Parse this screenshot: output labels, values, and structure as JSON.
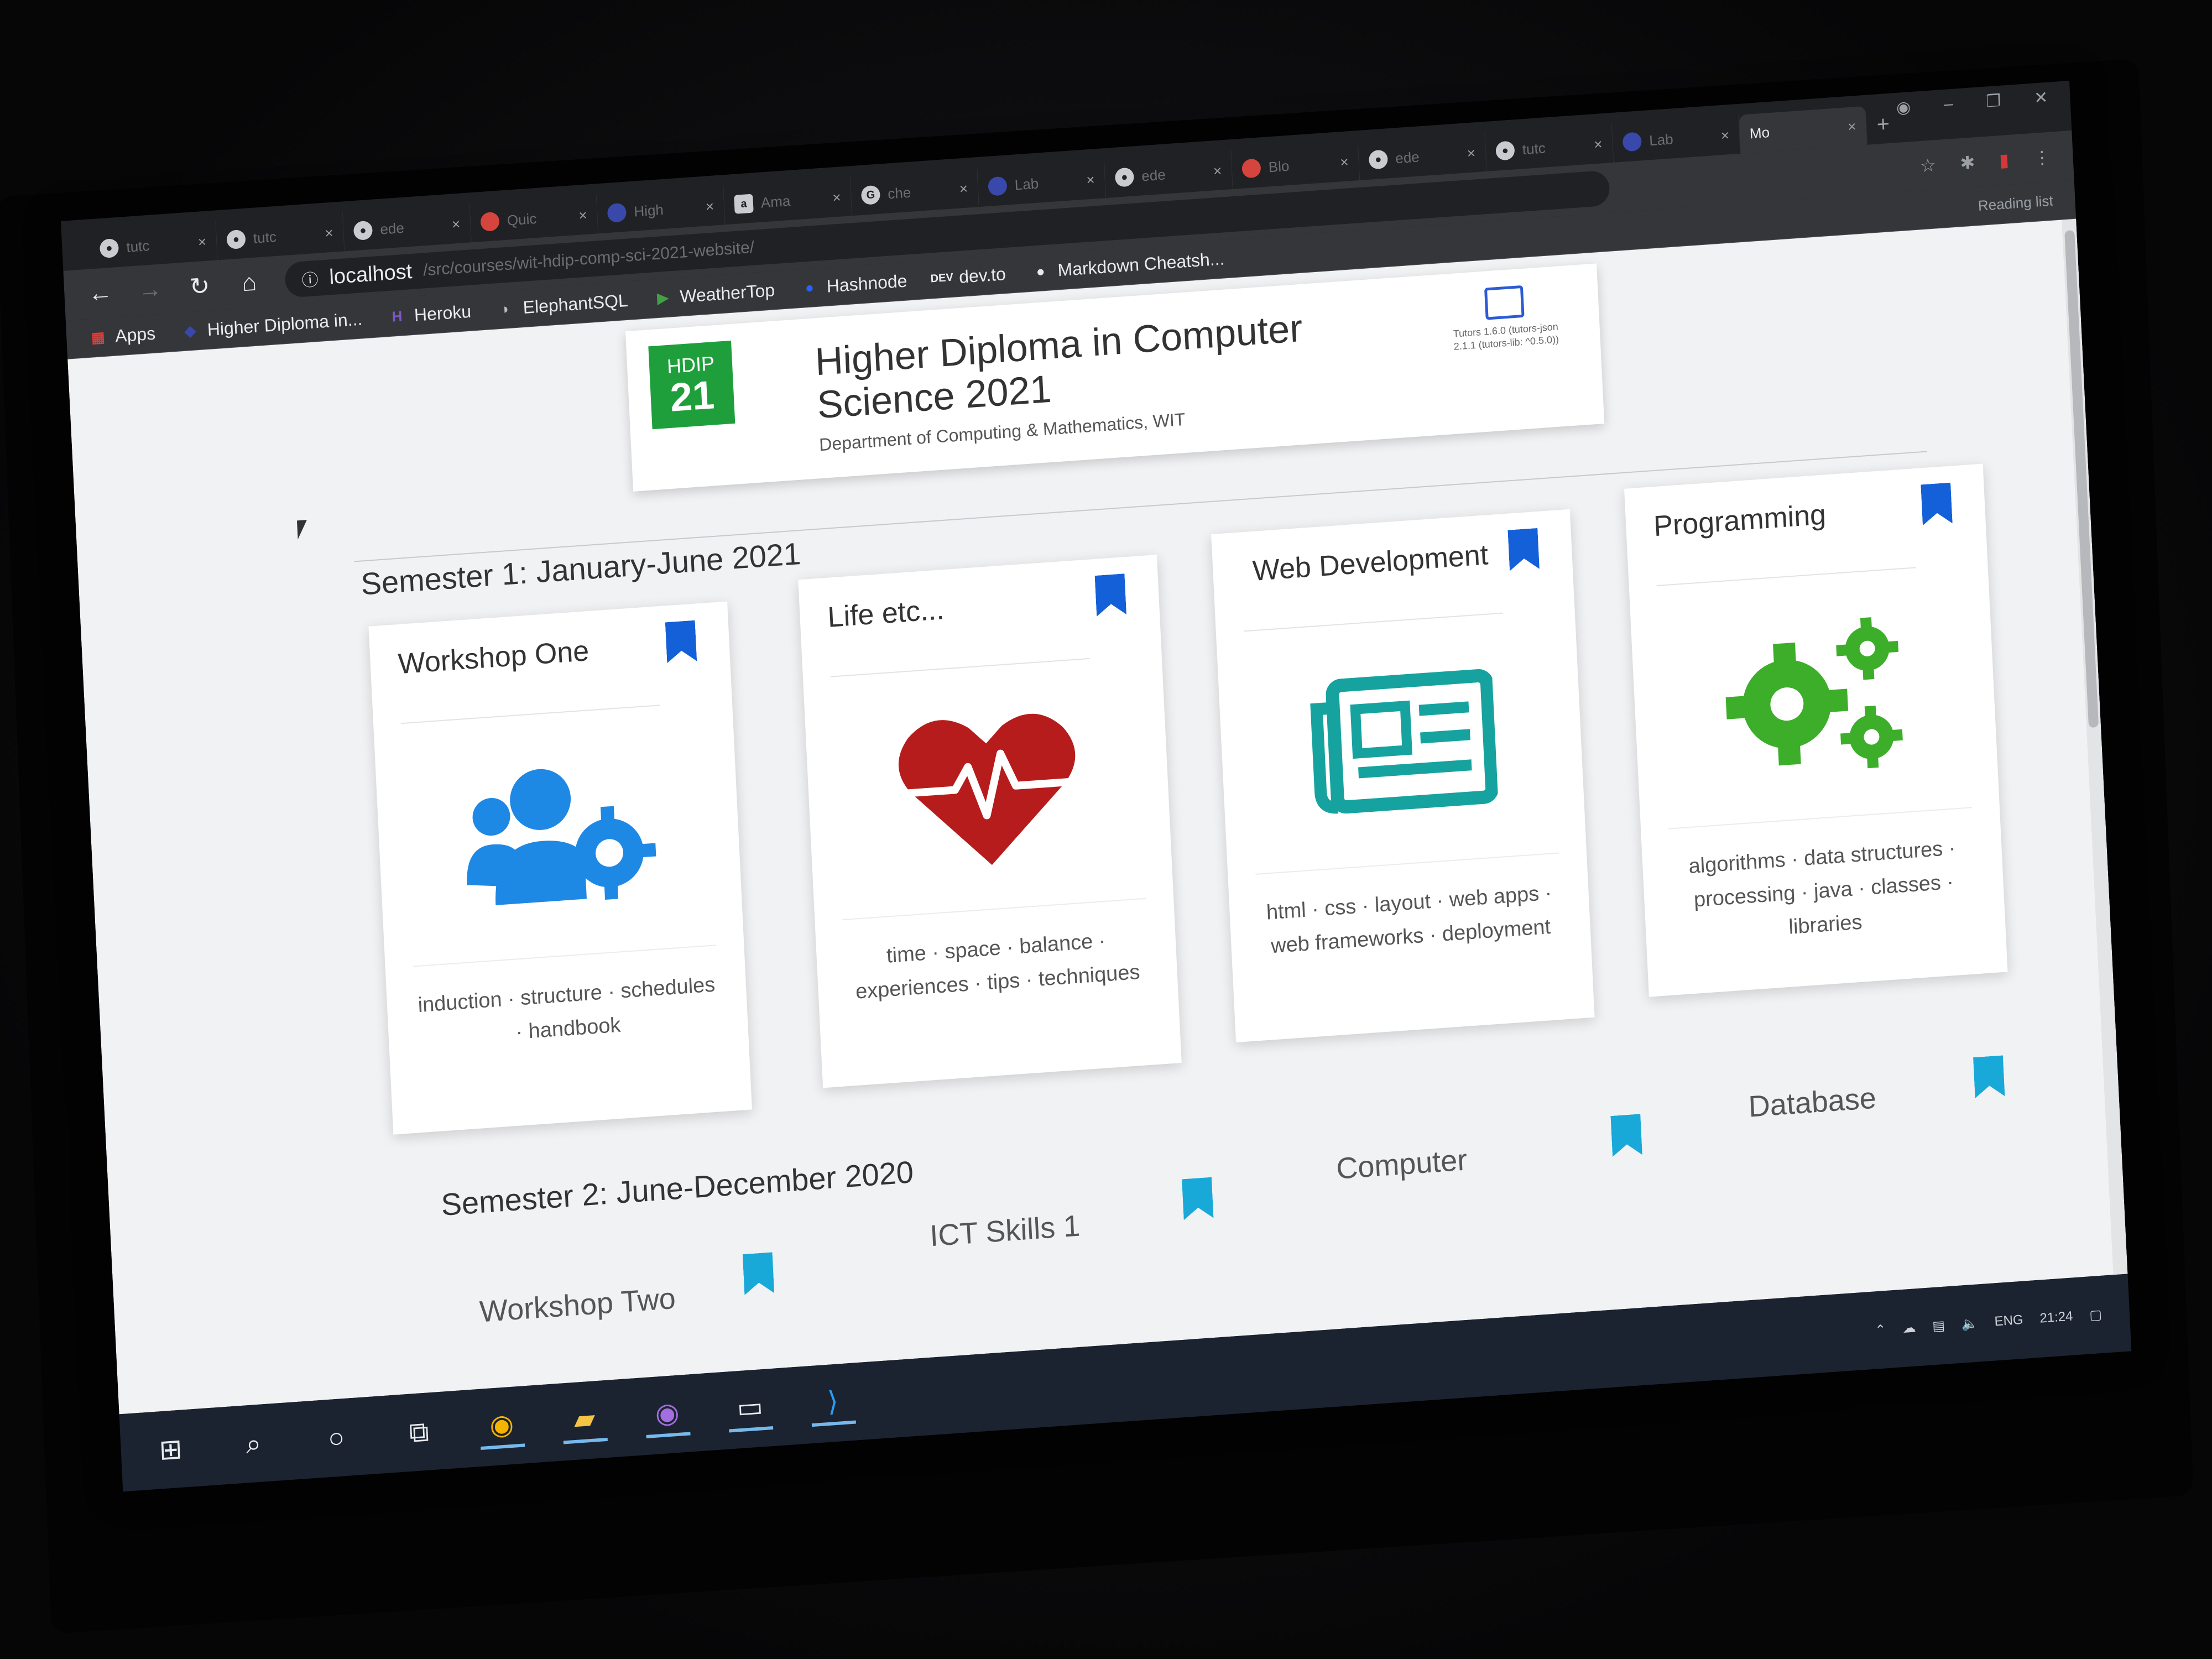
{
  "browser": {
    "tabs": [
      {
        "label": "tutc",
        "icon": "github-icon"
      },
      {
        "label": "tutc",
        "icon": "github-icon"
      },
      {
        "label": "ede",
        "icon": "github-icon"
      },
      {
        "label": "Quic",
        "icon": "app-icon"
      },
      {
        "label": "High",
        "icon": "app-icon"
      },
      {
        "label": "Ama",
        "icon": "amazon-icon"
      },
      {
        "label": "che",
        "icon": "google-icon"
      },
      {
        "label": "Lab",
        "icon": "app-icon"
      },
      {
        "label": "ede",
        "icon": "github-icon"
      },
      {
        "label": "Blo",
        "icon": "app-icon"
      },
      {
        "label": "ede",
        "icon": "github-icon"
      },
      {
        "label": "tutc",
        "icon": "github-icon"
      },
      {
        "label": "Lab",
        "icon": "app-icon"
      },
      {
        "label": "Mo",
        "icon": "app-icon"
      }
    ],
    "address": "localhost",
    "address_path": "/src/courses/wit-hdip-comp-sci-2021-website/",
    "reading_list": "Reading list"
  },
  "bookmarks": [
    {
      "label": "Apps",
      "icon": "apps-grid-icon"
    },
    {
      "label": "Higher Diploma in...",
      "icon": "app-icon"
    },
    {
      "label": "Heroku",
      "icon": "heroku-icon"
    },
    {
      "label": "ElephantSQL",
      "icon": "elephant-icon"
    },
    {
      "label": "WeatherTop",
      "icon": "play-icon"
    },
    {
      "label": "Hashnode",
      "icon": "hashnode-icon"
    },
    {
      "label": "dev.to",
      "icon": "devto-icon"
    },
    {
      "label": "Markdown Cheatsh...",
      "icon": "github-icon"
    }
  ],
  "header": {
    "logo_top": "HDIP",
    "logo_num": "21",
    "title": "Higher Diploma in Computer Science 2021",
    "subtitle": "Department of Computing & Mathematics, WIT",
    "version": "Tutors 1.6.0 (tutors-json 2.1.1 (tutors-lib: ^0.5.0))"
  },
  "semester1": {
    "heading": "Semester 1: January-June 2021",
    "cards": [
      {
        "title": "Workshop One",
        "desc": "induction · structure · schedules · handbook",
        "icon": "users-gear-icon",
        "color": "#1e88e5"
      },
      {
        "title": "Life etc...",
        "desc": "time · space · balance · experiences · tips · techniques",
        "icon": "heartbeat-icon",
        "color": "#b71c1c"
      },
      {
        "title": "Web Development",
        "desc": "html · css · layout · web apps · web frameworks · deployment",
        "icon": "newspaper-icon",
        "color": "#16a3a0"
      },
      {
        "title": "Programming",
        "desc": "algorithms · data structures · processing · java · classes · libraries",
        "icon": "cogs-icon",
        "color": "#3cae2a"
      }
    ]
  },
  "semester2": {
    "heading": "Semester 2: June-December 2020",
    "cards": [
      {
        "title": "Workshop Two"
      },
      {
        "title": "ICT Skills 1"
      },
      {
        "title": "Computer"
      },
      {
        "title": "Database"
      }
    ]
  },
  "taskbar": {
    "items": [
      "windows-start-icon",
      "search-icon",
      "cortana-icon",
      "task-view-icon",
      "chrome-icon",
      "file-explorer-icon",
      "github-desktop-icon",
      "terminal-icon",
      "vscode-icon"
    ],
    "lang": "ENG",
    "time": "21:24"
  }
}
